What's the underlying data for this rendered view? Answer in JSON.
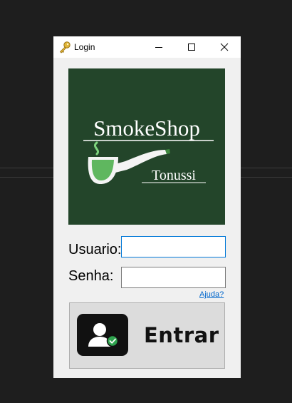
{
  "window": {
    "title": "Login",
    "title_icon": "key-icon",
    "controls": [
      "minimize-icon",
      "maximize-icon",
      "close-icon"
    ]
  },
  "logo": {
    "brand": "SmokeShop",
    "subtitle": "Tonussi",
    "graphic": "pipe-icon",
    "bg_color": "#23452a"
  },
  "form": {
    "username_label": "Usuario:",
    "username_value": "",
    "password_label": "Senha:",
    "password_value": "",
    "help_link": "Ajuda?"
  },
  "login_button": {
    "label": "Entrar",
    "icon": "user-check-icon"
  },
  "colors": {
    "accent_link": "#0066cc",
    "focus_border": "#0078d7",
    "check_green": "#2fa44f"
  }
}
